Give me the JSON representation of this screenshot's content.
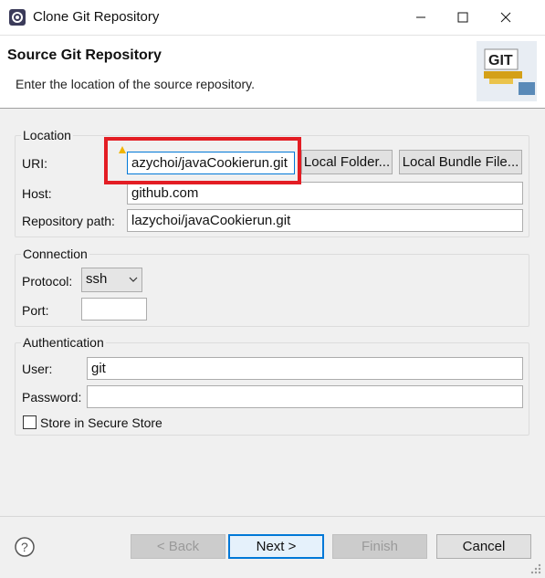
{
  "window": {
    "title": "Clone Git Repository"
  },
  "header": {
    "title": "Source Git Repository",
    "subtitle": "Enter the location of the source repository.",
    "logo_text": "GIT"
  },
  "location": {
    "group_title": "Location",
    "uri_label": "URI:",
    "uri_value": "azychoi/javaCookierun.git",
    "local_folder_label": "Local Folder...",
    "local_bundle_label": "Local Bundle File...",
    "host_label": "Host:",
    "host_value": "github.com",
    "repo_path_label": "Repository path:",
    "repo_path_value": "lazychoi/javaCookierun.git"
  },
  "connection": {
    "group_title": "Connection",
    "protocol_label": "Protocol:",
    "protocol_value": "ssh",
    "port_label": "Port:",
    "port_value": ""
  },
  "authentication": {
    "group_title": "Authentication",
    "user_label": "User:",
    "user_value": "git",
    "password_label": "Password:",
    "password_value": "",
    "store_label": "Store in Secure Store",
    "store_checked": false
  },
  "footer": {
    "back_label": "< Back",
    "next_label": "Next >",
    "finish_label": "Finish",
    "cancel_label": "Cancel"
  },
  "colors": {
    "accent": "#0078d7",
    "highlight_box": "#e31d24"
  }
}
